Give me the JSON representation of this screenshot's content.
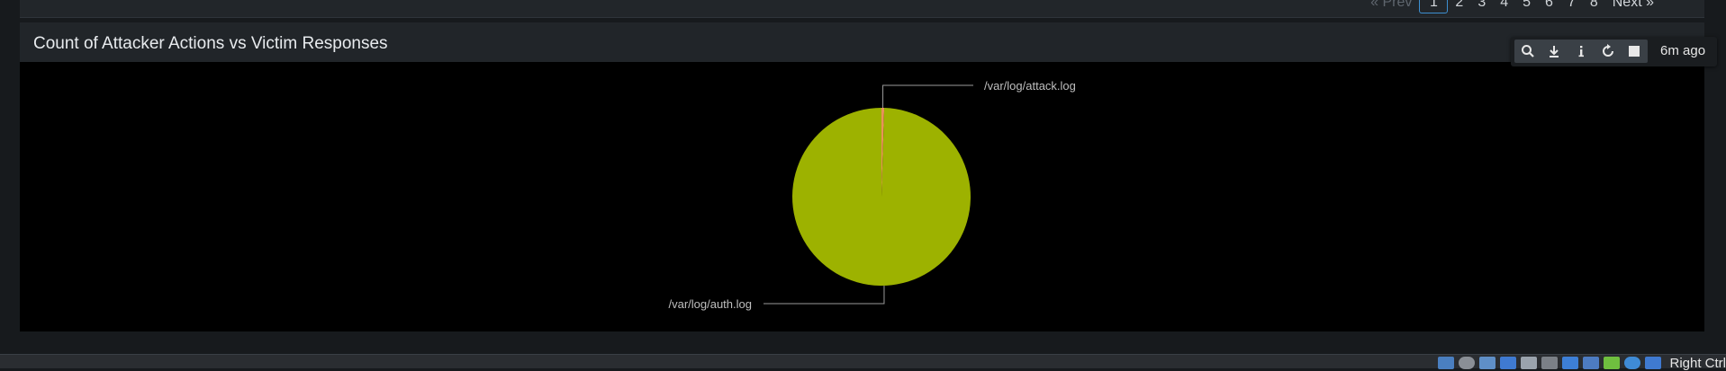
{
  "pager": {
    "prev_label": "« Prev",
    "pages": [
      "1",
      "2",
      "3",
      "4",
      "5",
      "6",
      "7",
      "8"
    ],
    "active_page": "1",
    "next_label": "Next »"
  },
  "panel": {
    "title": "Count of Attacker Actions vs Victim Responses"
  },
  "toolbar": {
    "buttons": [
      "search-icon",
      "download-icon",
      "info-icon",
      "refresh-icon",
      "stop-icon"
    ],
    "last_updated": "6m ago"
  },
  "chart_data": {
    "type": "pie",
    "title": "",
    "slices": [
      {
        "label": "/var/log/auth.log",
        "value": 99.5,
        "color": "#9db200"
      },
      {
        "label": "/var/log/attack.log",
        "value": 0.5,
        "color": "#e8925a"
      }
    ],
    "legend": "none",
    "background": "#000000"
  },
  "taskbar": {
    "tray_text": "Right Ctrl",
    "icons": [
      "network-icon",
      "disc-icon",
      "folder-icon",
      "display-icon",
      "usb-icon",
      "storage-icon",
      "screen-icon",
      "shared-icon",
      "vm-icon",
      "globe-icon",
      "keyboard-icon"
    ]
  }
}
